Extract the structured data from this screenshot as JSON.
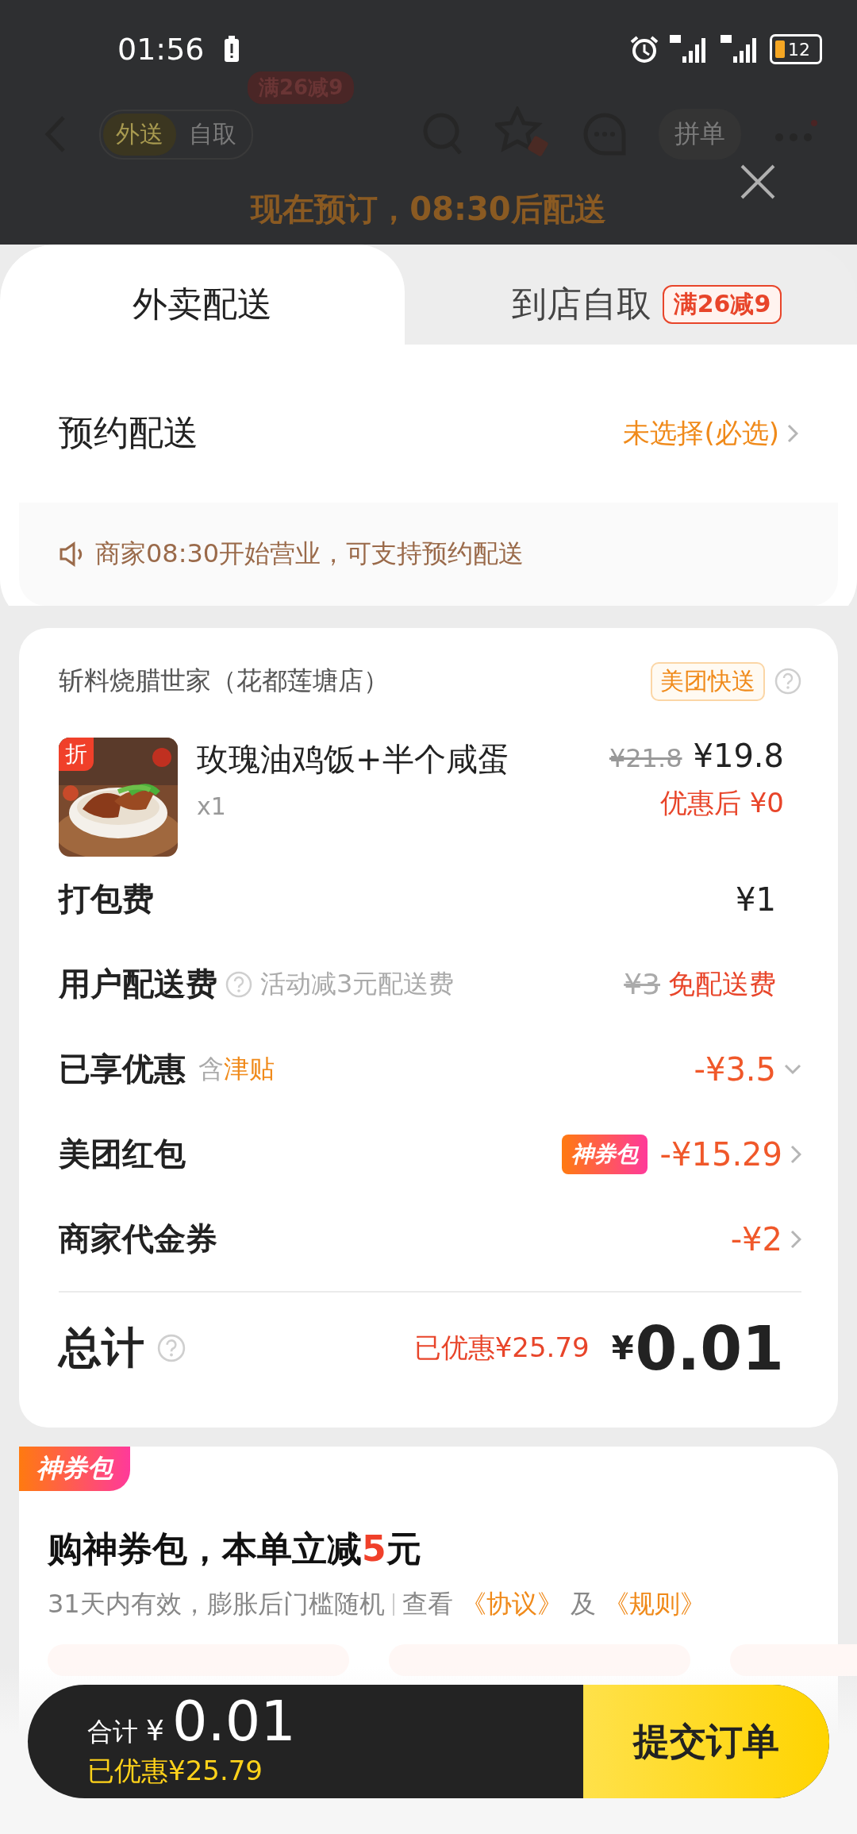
{
  "status_bar": {
    "time": "01:56",
    "battery": "12"
  },
  "background_page": {
    "tabs": [
      {
        "label": "外送",
        "selected": true
      },
      {
        "label": "自取",
        "selected": false
      }
    ],
    "promo_badge": "满26减9",
    "group_order": "拼单",
    "notice": "现在预订，08:30后配送"
  },
  "sheet_tabs": [
    {
      "label": "外卖配送",
      "selected": true
    },
    {
      "label": "到店自取",
      "selected": false,
      "badge": "满26减9"
    }
  ],
  "schedule": {
    "label": "预约配送",
    "value": "未选择(必选)",
    "notice": "商家08:30开始营业，可支持预约配送"
  },
  "order": {
    "store": "斩料烧腊世家（花都莲塘店）",
    "delivery_tag": "美团快送",
    "items": [
      {
        "name": "玫瑰油鸡饭+半个咸蛋",
        "quantity": "x1",
        "discount_tag": "折",
        "original_price": "¥21.8",
        "price": "¥19.8",
        "after_discount": "优惠后 ¥0"
      }
    ],
    "fees": [
      {
        "kind": "plain",
        "label": "打包费",
        "value": "¥1"
      },
      {
        "kind": "delivery",
        "label": "用户配送费",
        "note": "活动减3元配送费",
        "original": "¥3",
        "value": "免配送费"
      },
      {
        "kind": "expand",
        "label": "已享优惠",
        "note": "含",
        "note_highlight": "津贴",
        "value": "-¥3.5"
      },
      {
        "kind": "link",
        "label": "美团红包",
        "badge": "神券包",
        "value": "-¥15.29"
      },
      {
        "kind": "link",
        "label": "商家代金券",
        "value": "-¥2"
      }
    ],
    "total": {
      "label": "总计",
      "saved": "已优惠¥25.79",
      "currency": "¥",
      "amount": "0.01"
    }
  },
  "coupon_pack": {
    "tag": "神券包",
    "title_before": "购神券包，本单立减",
    "title_highlight": "5",
    "title_after": "元",
    "subtitle": "31天内有效，膨胀后门槛随机",
    "view": "查看",
    "agreement": "《协议》",
    "and": "及",
    "rules": "《规则》"
  },
  "checkout": {
    "label": "合计",
    "currency": "¥",
    "amount": "0.01",
    "saved": "已优惠¥25.79",
    "submit": "提交订单"
  }
}
